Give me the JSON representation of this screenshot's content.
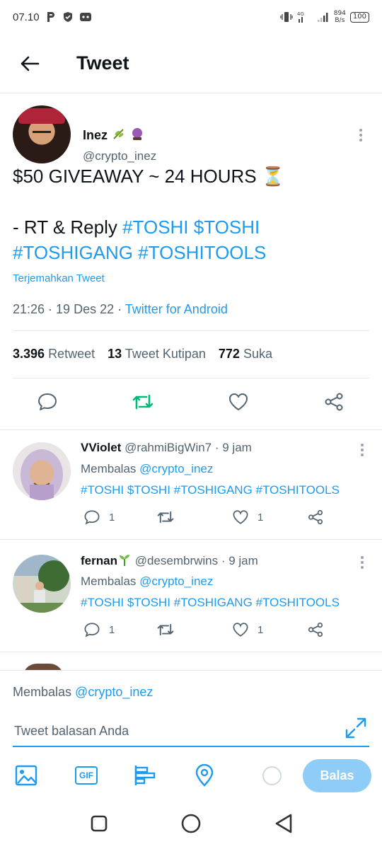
{
  "status_bar": {
    "time": "07.10",
    "network": "4G",
    "speed_value": "894",
    "speed_unit": "B/s",
    "battery": "100"
  },
  "header": {
    "title": "Tweet",
    "back_icon": "arrow-left-icon"
  },
  "main_tweet": {
    "author_name": "Inez",
    "author_handle": "@crypto_inez",
    "line1": "$50 GIVEAWAY ~ 24 HOURS ⏳",
    "line2_prefix": "- RT & Reply ",
    "line2_tags": "#TOSHI $TOSHI",
    "line3_tags": "#TOSHIGANG #TOSHITOOLS",
    "translate": "Terjemahkan Tweet",
    "time": "21:26",
    "date": "19 Des 22",
    "source": "Twitter for Android",
    "stats": {
      "retweets_count": "3.396",
      "retweets_label": "Retweet",
      "quotes_count": "13",
      "quotes_label": "Tweet Kutipan",
      "likes_count": "772",
      "likes_label": "Suka"
    }
  },
  "replies": [
    {
      "name": "VViolet",
      "handle": "@rahmiBigWin7",
      "time": "9 jam",
      "replying_label": "Membalas",
      "replying_to": "@crypto_inez",
      "text": "#TOSHI $TOSHI #TOSHIGANG #TOSHITOOLS",
      "reply_count": "1",
      "like_count": "1"
    },
    {
      "name": "fernan",
      "handle": "@desembrwins",
      "time": "9 jam",
      "replying_label": "Membalas",
      "replying_to": "@crypto_inez",
      "text": "#TOSHI $TOSHI #TOSHIGANG #TOSHITOOLS",
      "reply_count": "1",
      "like_count": "1"
    }
  ],
  "compose": {
    "replying_label": "Membalas",
    "replying_to": "@crypto_inez",
    "placeholder": "Tweet balasan Anda",
    "gif_label": "GIF",
    "send_label": "Balas"
  },
  "colors": {
    "accent": "#1d9bf0",
    "retweet_green": "#00ba7c",
    "secondary_text": "#536471",
    "send_disabled": "#8ecdf8"
  }
}
